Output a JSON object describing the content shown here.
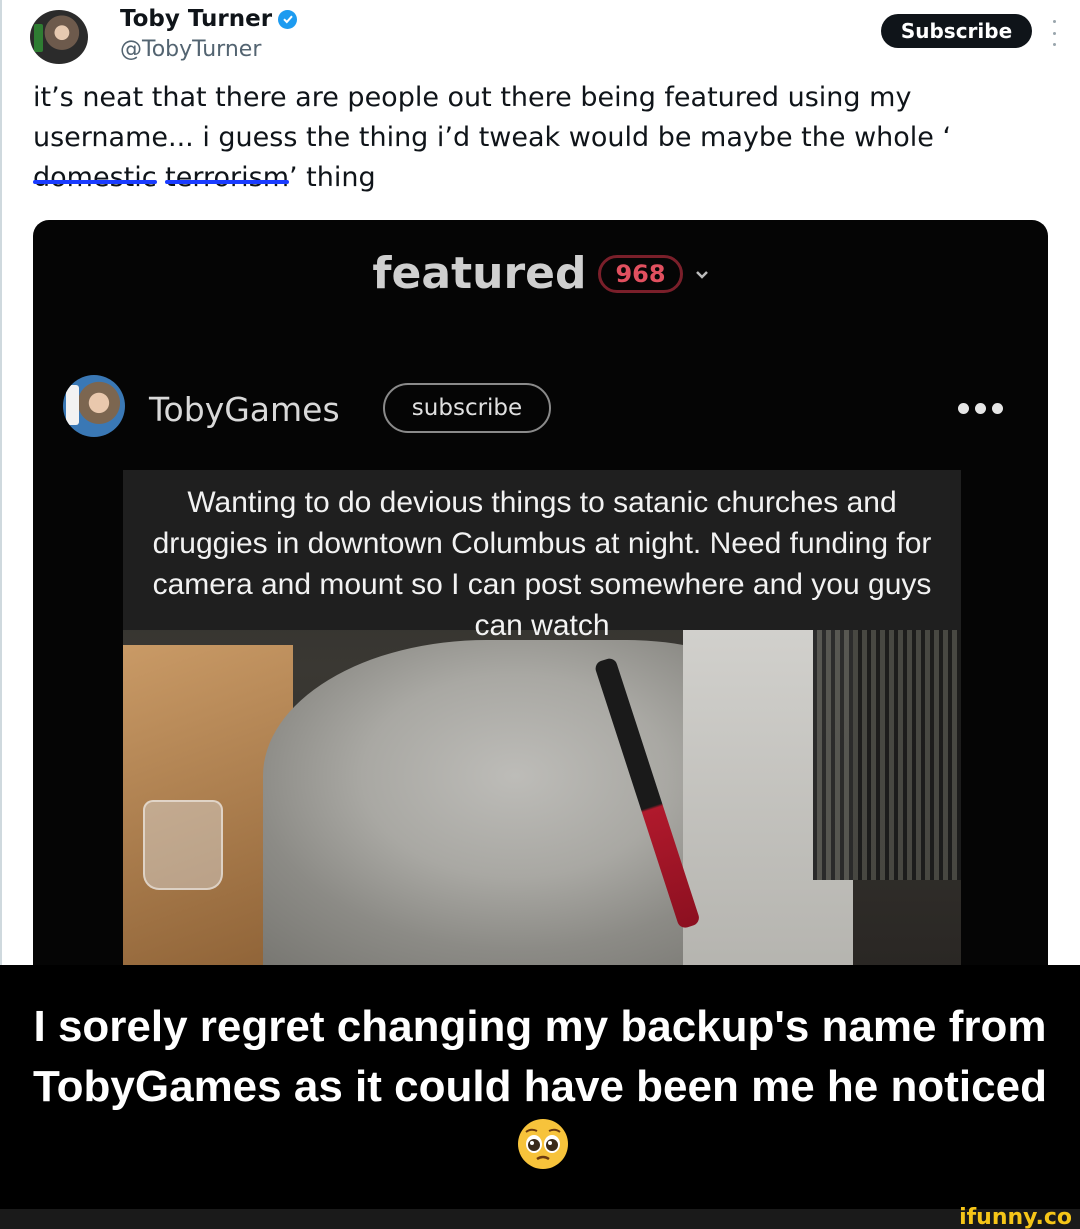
{
  "tweet": {
    "author_name": "Toby Turner",
    "handle": "@TobyTurner",
    "subscribe_label": "Subscribe",
    "text_before": "it’s neat that there are people out there being featured using my username... i guess the thing i’d tweak would be maybe the whole ‘",
    "struck_1": "domestic",
    "struck_2": "terrorism",
    "text_after": "’ thing"
  },
  "embedded": {
    "featured_label": "featured",
    "featured_count": "968",
    "channel_name": "TobyGames",
    "subscribe_label": "subscribe",
    "photo_caption": "Wanting to do devious things to satanic churches and druggies in downtown Columbus at night. Need funding for camera and mount so I can post somewhere and you guys can watch"
  },
  "meme": {
    "caption": "I sorely regret changing my backup's name from TobyGames as it could have been me he noticed",
    "emoji": "pleading-face-icon"
  },
  "watermark": "ifunny.co",
  "colors": {
    "verified": "#1d9bf0",
    "strike": "#1a3cff",
    "badge_text": "#e1505f",
    "watermark": "#f5c518"
  }
}
